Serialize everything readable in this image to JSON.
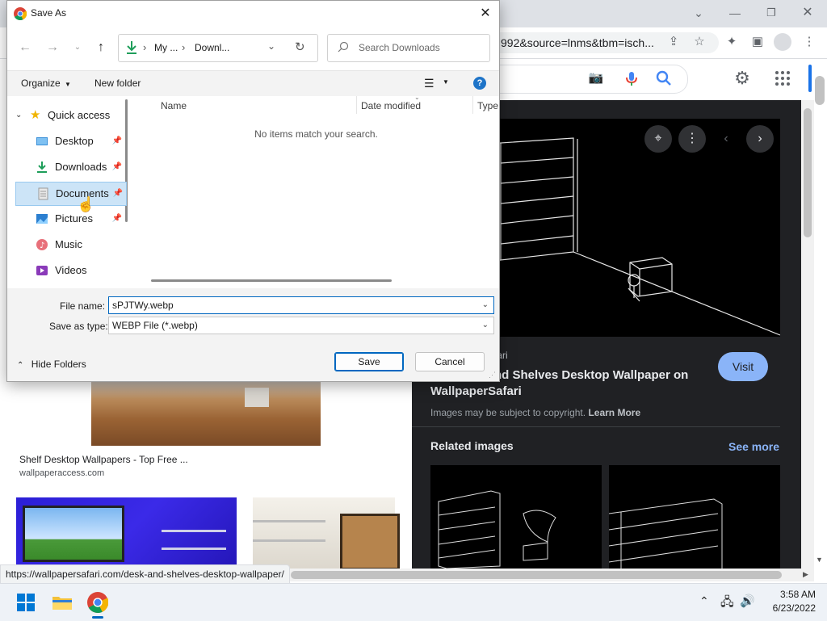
{
  "browser": {
    "url_fragment": "992&source=lnms&tbm=isch...",
    "panel": {
      "source_suffix": "fari",
      "title_line1": "nd Shelves Desktop Wallpaper on",
      "title_line2": "WallpaperSafari",
      "visit_label": "Visit",
      "copyright_text": "Images may be subject to copyright.",
      "learn_more": "Learn More",
      "related_heading": "Related images",
      "see_more": "See more"
    },
    "results": {
      "item1_title": "Shelf Desktop Wallpapers - Top Free ...",
      "item1_source": "wallpaperaccess.com"
    },
    "status_url": "https://wallpapersafari.com/desk-and-shelves-desktop-wallpaper/"
  },
  "dialog": {
    "title": "Save As",
    "breadcrumb": [
      "My ...",
      "Downl..."
    ],
    "search_placeholder": "Search Downloads",
    "organize_label": "Organize",
    "new_folder_label": "New folder",
    "tree": [
      {
        "label": "Quick access"
      },
      {
        "label": "Desktop",
        "pinned": true
      },
      {
        "label": "Downloads",
        "pinned": true
      },
      {
        "label": "Documents",
        "pinned": true,
        "selected": true
      },
      {
        "label": "Pictures",
        "pinned": true
      },
      {
        "label": "Music"
      },
      {
        "label": "Videos"
      }
    ],
    "columns": [
      "Name",
      "Date modified",
      "Type"
    ],
    "empty_message": "No items match your search.",
    "file_name_label": "File name:",
    "file_name_value": "sPJTWy.webp",
    "save_as_type_label": "Save as type:",
    "save_as_type_value": "WEBP File (*.webp)",
    "hide_folders_label": "Hide Folders",
    "save_label": "Save",
    "cancel_label": "Cancel"
  },
  "taskbar": {
    "time": "3:58 AM",
    "date": "6/23/2022"
  },
  "colors": {
    "accent": "#0067c0",
    "visit_button": "#8ab4f8",
    "panel_bg": "#202124",
    "see_more": "#8ab4f8"
  }
}
